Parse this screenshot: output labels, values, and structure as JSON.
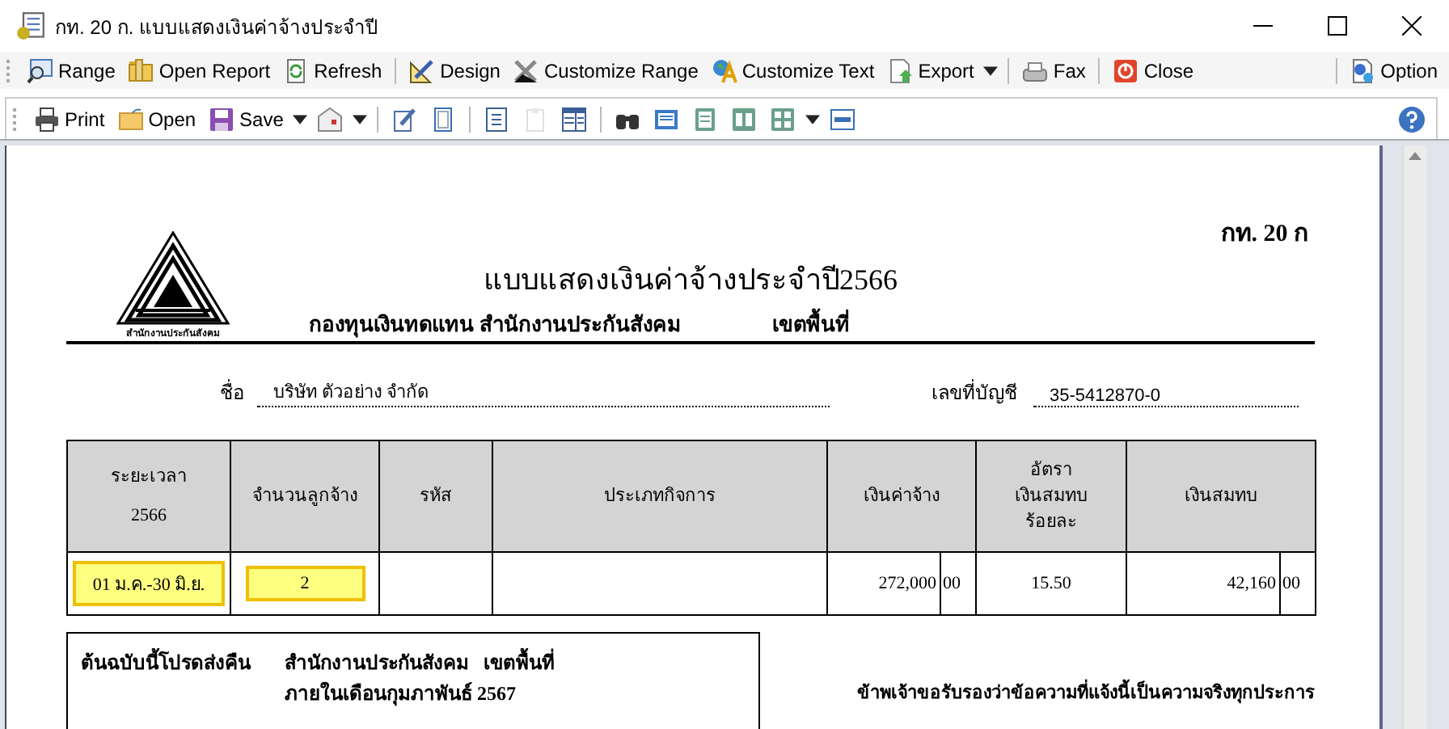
{
  "window": {
    "title": "กท. 20 ก. แบบแสดงเงินค่าจ้างประจำปี"
  },
  "toolbar": [
    {
      "kind": "button",
      "label": "Range"
    },
    {
      "kind": "button",
      "label": "Open Report"
    },
    {
      "kind": "button",
      "label": "Refresh"
    },
    {
      "kind": "separator"
    },
    {
      "kind": "button",
      "label": "Design"
    },
    {
      "kind": "button",
      "label": "Customize Range"
    },
    {
      "kind": "button",
      "label": "Customize Text"
    },
    {
      "kind": "button",
      "label": "Export",
      "dropdown": true
    },
    {
      "kind": "separator"
    },
    {
      "kind": "button",
      "label": "Fax"
    },
    {
      "kind": "separator"
    },
    {
      "kind": "button",
      "label": "Close"
    },
    {
      "kind": "spacer"
    },
    {
      "kind": "separator"
    },
    {
      "kind": "button",
      "label": "Option"
    }
  ],
  "preview_toolbar": [
    {
      "kind": "button",
      "label": "Print",
      "disabled": false
    },
    {
      "kind": "button",
      "label": "Open",
      "disabled": false
    },
    {
      "kind": "button",
      "label": "Save",
      "dropdown": true,
      "disabled": false
    },
    {
      "kind": "icon",
      "dropdown": true,
      "disabled": false
    },
    {
      "kind": "separator"
    },
    {
      "kind": "icon",
      "disabled": false
    },
    {
      "kind": "icon",
      "disabled": false
    },
    {
      "kind": "separator"
    },
    {
      "kind": "icon",
      "disabled": false
    },
    {
      "kind": "icon",
      "disabled": true
    },
    {
      "kind": "icon",
      "disabled": false
    },
    {
      "kind": "separator"
    },
    {
      "kind": "icon",
      "disabled": false
    },
    {
      "kind": "icon",
      "disabled": false
    },
    {
      "kind": "icon",
      "disabled": false
    },
    {
      "kind": "icon",
      "disabled": false
    },
    {
      "kind": "icon",
      "dropdown": true,
      "disabled": false
    },
    {
      "kind": "icon",
      "disabled": false
    },
    {
      "kind": "spacer"
    },
    {
      "kind": "icon",
      "disabled": false
    }
  ],
  "report": {
    "form_code": "กท. 20 ก",
    "title": "แบบแสดงเงินค่าจ้างประจำปี2566",
    "logo_caption": "สำนักงานประกันสังคม",
    "office": "กองทุนเงินทดแทน สำนักงานประกันสังคม",
    "area_label": "เขตพื้นที่",
    "name_label": "ชื่อ",
    "name": "บริษัท ตัวอย่าง จำกัด",
    "account_label": "เลขที่บัญชี",
    "account": "35-5412870-0",
    "table": {
      "columns": [
        {
          "lines": [
            "ระยะเวลา",
            "2566"
          ]
        },
        {
          "lines": [
            "จำนวนลูกจ้าง"
          ]
        },
        {
          "lines": [
            "รหัส"
          ]
        },
        {
          "lines": [
            "ประเภทกิจการ"
          ]
        },
        {
          "lines": [
            "เงินค่าจ้าง"
          ]
        },
        {
          "lines": [
            "อัตรา",
            "เงินสมทบ",
            "ร้อยละ"
          ]
        },
        {
          "lines": [
            "เงินสมทบ"
          ]
        }
      ],
      "rows": [
        {
          "cells": [
            {
              "kind": "highlight",
              "text": "01 ม.ค.-30 มิ.ย."
            },
            {
              "kind": "highlight",
              "text": "2"
            },
            {
              "kind": "blank"
            },
            {
              "kind": "blank"
            },
            {
              "kind": "money",
              "baht": "272,000",
              "satang": "00"
            },
            {
              "kind": "plain",
              "text": "15.50"
            },
            {
              "kind": "money",
              "baht": "42,160",
              "satang": "00"
            }
          ]
        }
      ]
    },
    "return_label": "ต้นฉบับนี้โปรดส่งคืน",
    "return_office": "สำนักงานประกันสังคม   เขตพื้นที่",
    "deadline": "ภายในเดือนกุมภาพันธ์ 2567",
    "certification": "ข้าพเจ้าขอรับรองว่าข้อความที่แจ้งนี้เป็นความจริงทุกประการ"
  }
}
